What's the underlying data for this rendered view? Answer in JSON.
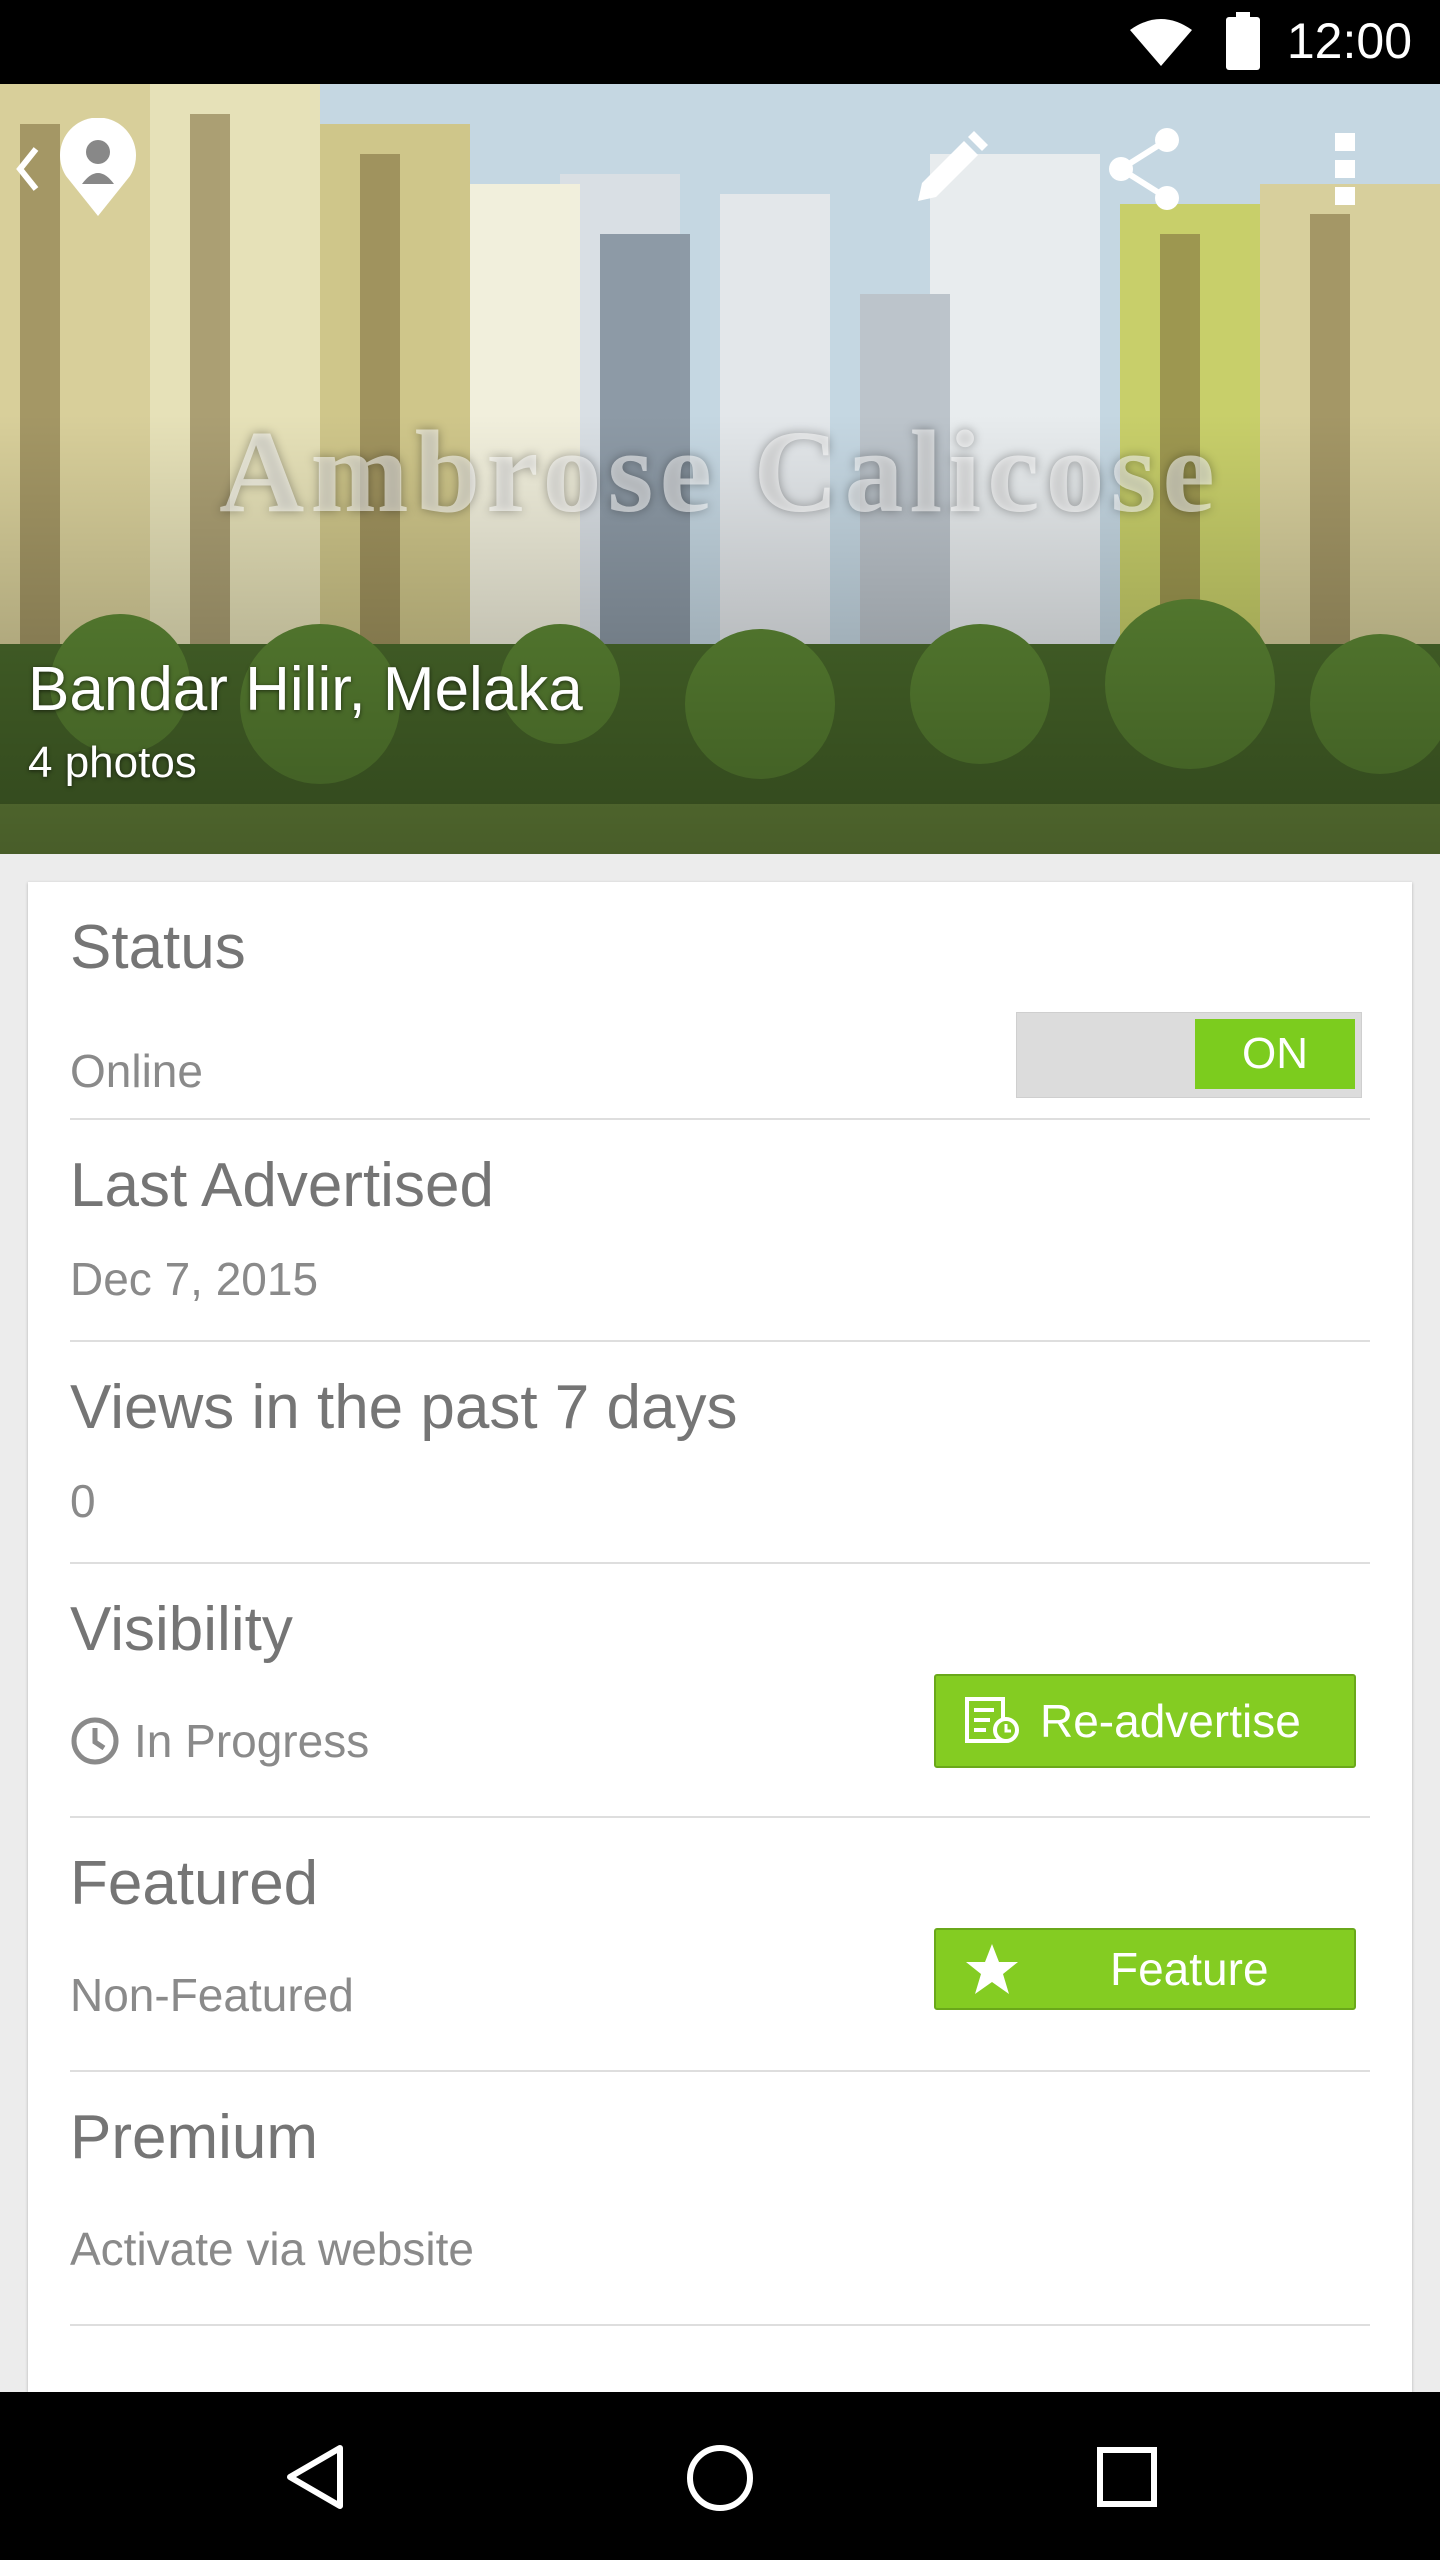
{
  "status_bar": {
    "time": "12:00"
  },
  "hero": {
    "watermark": "Ambrose Calicose",
    "location": "Bandar Hilir, Melaka",
    "photos": "4 photos"
  },
  "sections": {
    "status": {
      "title": "Status",
      "value": "Online",
      "toggle_label": "ON"
    },
    "last_advertised": {
      "title": "Last Advertised",
      "value": "Dec 7, 2015"
    },
    "views": {
      "title": "Views in the past 7 days",
      "value": "0"
    },
    "visibility": {
      "title": "Visibility",
      "value": "In Progress",
      "button_label": "Re-advertise"
    },
    "featured": {
      "title": "Featured",
      "value": "Non-Featured",
      "button_label": "Feature"
    },
    "premium": {
      "title": "Premium",
      "value": "Activate via website"
    }
  },
  "colors": {
    "accent": "#84cc22",
    "toggle_on": "#7ccc1e"
  },
  "icons": [
    "wifi-icon",
    "battery-icon",
    "back-icon",
    "agent-pin-icon",
    "edit-icon",
    "share-icon",
    "overflow-menu-icon",
    "clock-icon",
    "advertise-icon",
    "star-icon",
    "nav-back-icon",
    "nav-home-icon",
    "nav-recents-icon"
  ]
}
